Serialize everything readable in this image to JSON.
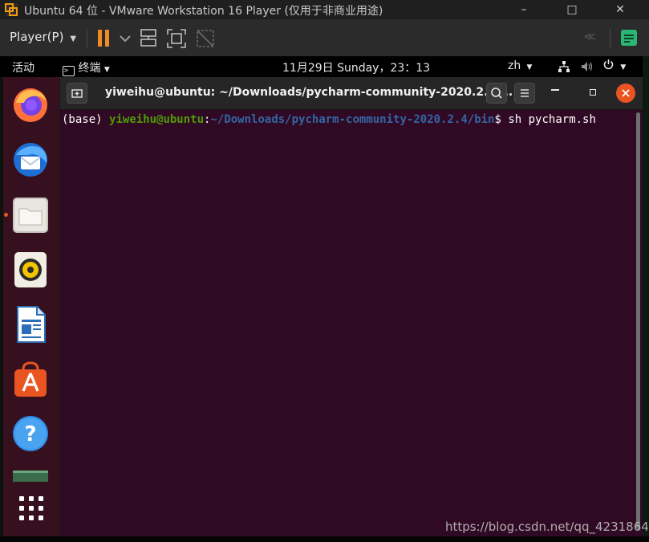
{
  "vmware": {
    "title": "Ubuntu 64 位 - VMware Workstation 16 Player (仅用于非商业用途)",
    "player_menu_label": "Player(P)",
    "window_buttons": [
      "–",
      "□",
      "✕"
    ]
  },
  "ubuntu_topbar": {
    "activities": "活动",
    "app_menu": "终端",
    "clock": "11月29日 Sunday，23：13",
    "input_method": "zh"
  },
  "terminal": {
    "title": "yiweihu@ubuntu: ~/Downloads/pycharm-community-2020.2.4/...",
    "prompt_env": "(base) ",
    "prompt_user_host": "yiweihu@ubuntu",
    "prompt_colon": ":",
    "prompt_path": "~/Downloads/pycharm-community-2020.2.4/bin",
    "prompt_symbol": "$ ",
    "command": "sh pycharm.sh"
  },
  "dock": {
    "apps": [
      "firefox",
      "thunderbird",
      "files",
      "rhythmbox",
      "libreoffice-writer",
      "ubuntu-software",
      "help",
      "screenshot",
      "show-applications"
    ]
  },
  "watermark": "https://blog.csdn.net/qq_42318647",
  "colors": {
    "terminal_bg": "#300a24",
    "prompt_green": "#4e9a06",
    "prompt_blue": "#3465a4",
    "ubuntu_orange": "#e95420",
    "vmware_pause": "#f08a24"
  }
}
